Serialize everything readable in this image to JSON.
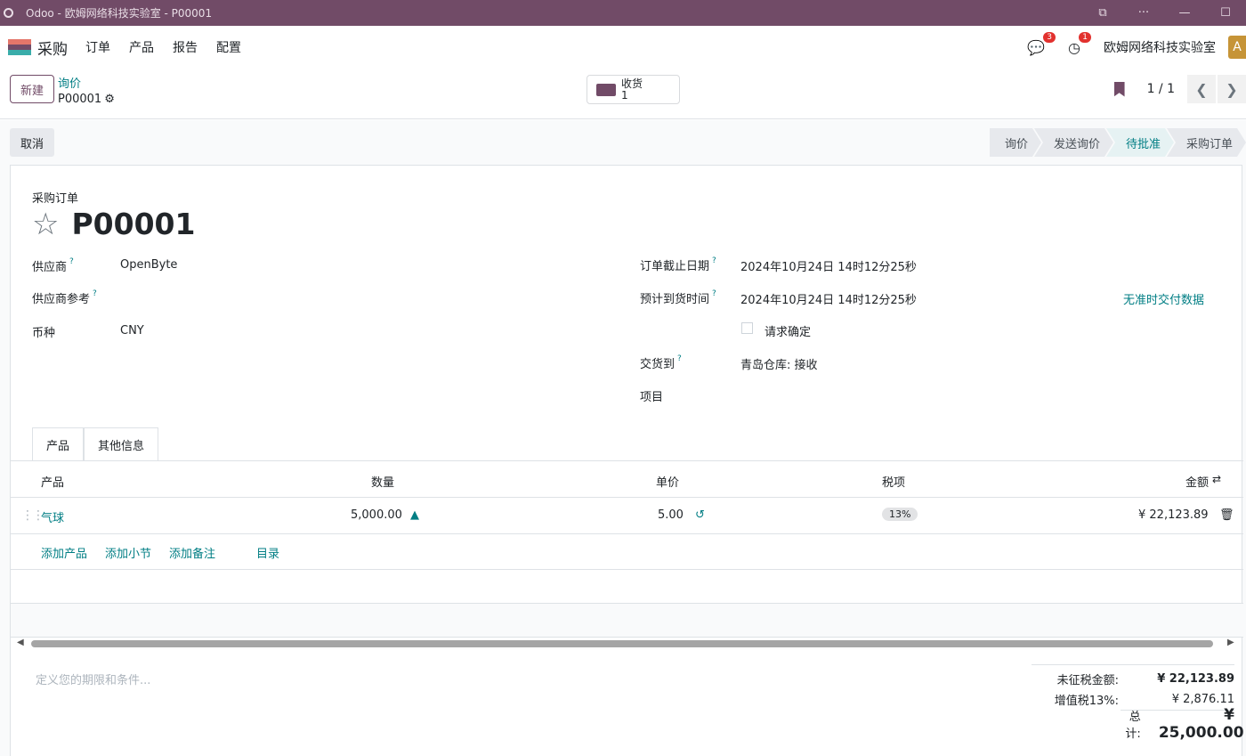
{
  "window": {
    "title": "Odoo - 欧姆网络科技实验室 - P00001",
    "controls": [
      "⧉",
      "···",
      "—",
      "☐"
    ]
  },
  "navbar": {
    "app_name": "采购",
    "menu": [
      "订单",
      "产品",
      "报告",
      "配置"
    ],
    "messages_count": "3",
    "activities_count": "1",
    "company": "欧姆网络科技实验室",
    "avatar_letter": "A",
    "brand_colors": [
      "#e4766a",
      "#714b67",
      "#3aadaa"
    ]
  },
  "control": {
    "new_label": "新建",
    "breadcrumb_parent": "询价",
    "breadcrumb_record": "P00001",
    "receipt_label": "收货",
    "receipt_count": "1",
    "pager_value": "1 / 1"
  },
  "statusbar": {
    "cancel_label": "取消",
    "stages": [
      "询价",
      "发送询价",
      "待批准",
      "采购订单"
    ],
    "active_stage": "待批准"
  },
  "form": {
    "doc_type": "采购订单",
    "doc_name": "P00001",
    "vendor_label": "供应商",
    "vendor_value": "OpenByte",
    "vendor_ref_label": "供应商参考",
    "currency_label": "币种",
    "currency_value": "CNY",
    "deadline_label": "订单截止日期",
    "deadline_value": "2024年10月24日 14时12分25秒",
    "expected_label": "预计到货时间",
    "expected_value": "2024年10月24日 14时12分25秒",
    "no_ontime_label": "无准时交付数据",
    "confirm_label": "请求确定",
    "deliver_to_label": "交货到",
    "deliver_to_value": "青岛仓库: 接收",
    "project_label": "项目",
    "q": "?"
  },
  "tabs": [
    "产品",
    "其他信息"
  ],
  "lines": {
    "headers": {
      "product": "产品",
      "qty": "数量",
      "price": "单价",
      "tax": "税项",
      "amount": "金额"
    },
    "rows": [
      {
        "product": "气球",
        "qty": "5,000.00",
        "price": "5.00",
        "tax": "13%",
        "amount": "¥ 22,123.89"
      }
    ],
    "add_product": "添加产品",
    "add_section": "添加小节",
    "add_note": "添加备注",
    "catalog": "目录"
  },
  "footer": {
    "terms_placeholder": "定义您的期限和条件...",
    "untaxed_label": "未征税金额:",
    "untaxed_value": "¥ 22,123.89",
    "vat_label": "增值税13%:",
    "vat_value": "¥ 2,876.11",
    "total_label": "总计:",
    "total_value": "¥ 25,000.00"
  }
}
